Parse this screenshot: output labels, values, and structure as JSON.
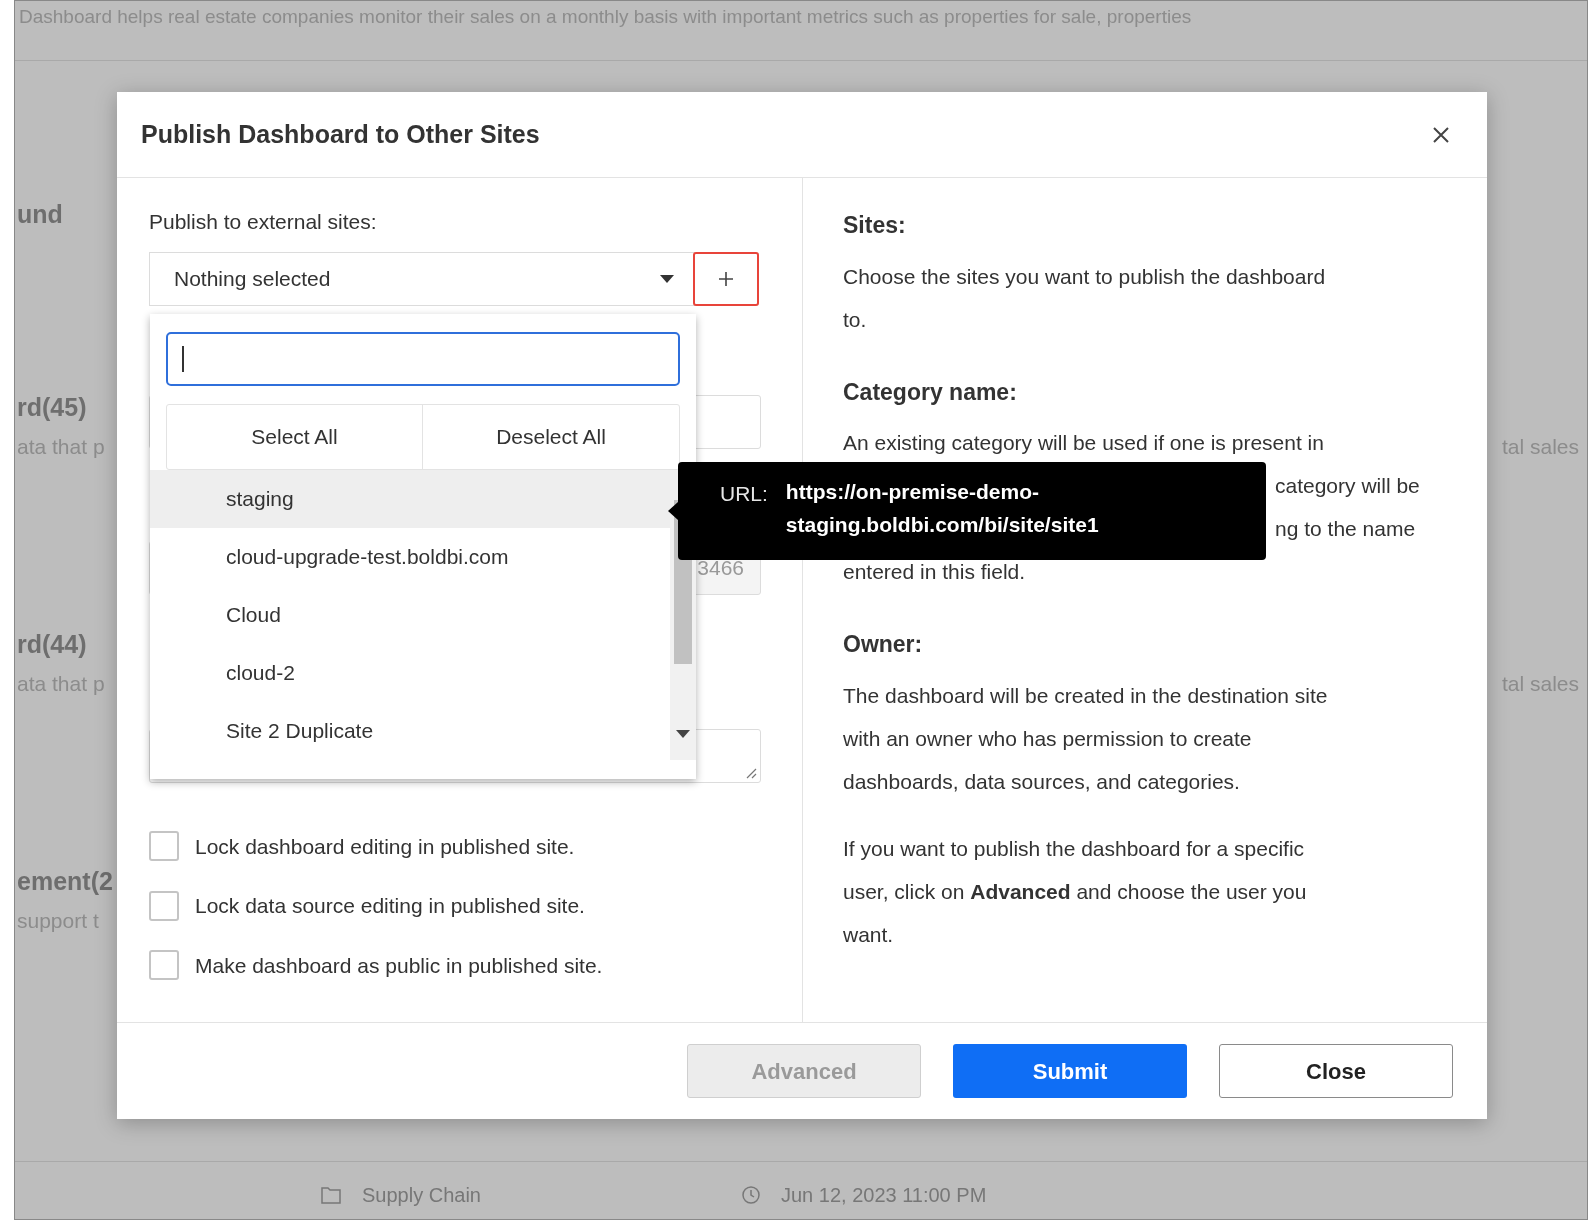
{
  "background": {
    "description": "Dashboard helps real estate companies monitor their sales on a monthly basis with important metrics such as properties for sale, properties",
    "rows": [
      {
        "title": "und"
      },
      {
        "title": "rd(45)",
        "subtitle": "ata that p",
        "right": "tal sales"
      },
      {
        "title": "rd(44)",
        "subtitle": "ata that p",
        "right": "tal sales"
      },
      {
        "title": "ement(2",
        "subtitle": "support t"
      }
    ],
    "footer_row": {
      "category": "Supply Chain",
      "date": "Jun 12, 2023 11:00 PM"
    }
  },
  "dialog": {
    "title": "Publish Dashboard to Other Sites",
    "left": {
      "label": "Publish to external sites:",
      "select": {
        "value": "Nothing selected"
      },
      "hidden_field_value": "3466",
      "dropdown": {
        "select_all": "Select All",
        "deselect_all": "Deselect All",
        "items": [
          {
            "label": "staging",
            "hovered": true
          },
          {
            "label": "cloud-upgrade-test.boldbi.com",
            "hovered": false
          },
          {
            "label": "Cloud",
            "hovered": false
          },
          {
            "label": "cloud-2",
            "hovered": false
          },
          {
            "label": "Site 2 Duplicate",
            "hovered": false
          }
        ]
      },
      "tooltip": {
        "label": "URL:",
        "url": "https://on-premise-demo-staging.boldbi.com/bi/site/site1"
      },
      "checkboxes": [
        {
          "label": "Lock dashboard editing in published site.",
          "checked": false
        },
        {
          "label": "Lock data source editing in published site.",
          "checked": false
        },
        {
          "label": "Make dashboard as public in published site.",
          "checked": false
        }
      ]
    },
    "right": {
      "sections": [
        {
          "heading": "Sites:",
          "paragraphs": [
            [
              "Choose the sites you want to publish the dashboard",
              "to."
            ]
          ]
        },
        {
          "heading": "Category name:",
          "paragraphs": [
            [
              "An existing category will be used if one is present in",
              "category will be",
              "ng to the name",
              "entered in this field."
            ]
          ]
        },
        {
          "heading": "Owner:",
          "paragraphs": [
            [
              "The dashboard will be created in the destination site",
              "with an owner who has permission to create",
              "dashboards, data sources, and categories."
            ],
            [
              "If you want to publish the dashboard for a specific",
              "user, click on **Advanced** and choose the user you",
              "want."
            ]
          ]
        }
      ]
    },
    "buttons": [
      {
        "label": "Advanced",
        "kind": "secondary",
        "disabled": true
      },
      {
        "label": "Submit",
        "kind": "primary",
        "disabled": false
      },
      {
        "label": "Close",
        "kind": "outline",
        "disabled": false
      }
    ]
  }
}
